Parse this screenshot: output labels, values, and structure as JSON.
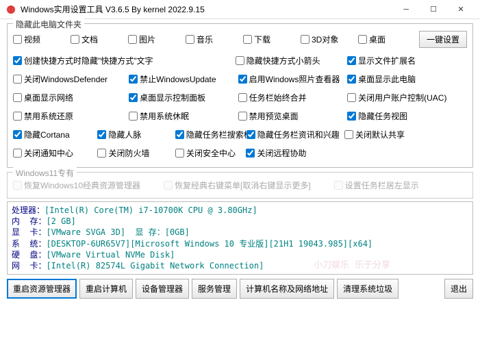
{
  "window": {
    "title": "Windows实用设置工具 V3.6.5 By kernel 2022.9.15"
  },
  "hideFolder": {
    "title": "隐藏此电脑文件夹",
    "items": [
      {
        "label": "视频",
        "checked": false
      },
      {
        "label": "文档",
        "checked": false
      },
      {
        "label": "图片",
        "checked": false
      },
      {
        "label": "音乐",
        "checked": false
      },
      {
        "label": "下载",
        "checked": false
      },
      {
        "label": "3D对象",
        "checked": false
      },
      {
        "label": "桌面",
        "checked": false
      }
    ],
    "batchBtn": "一键设置"
  },
  "opts": [
    {
      "label": "创建快捷方式时隐藏\"快捷方式\"文字",
      "checked": true,
      "span": 2
    },
    {
      "label": "隐藏快捷方式小箭头",
      "checked": false
    },
    {
      "label": "",
      "checked": false,
      "empty": true
    },
    {
      "label": "显示文件扩展名",
      "checked": true
    },
    {
      "label": "关闭WindowsDefender",
      "checked": false
    },
    {
      "label": "禁止WindowsUpdate",
      "checked": true
    },
    {
      "label": "启用Windows照片查看器",
      "checked": true
    },
    {
      "label": "桌面显示此电脑",
      "checked": true
    },
    {
      "label": "桌面显示网络",
      "checked": false
    },
    {
      "label": "桌面显示控制面板",
      "checked": true
    },
    {
      "label": "任务栏始终合并",
      "checked": false
    },
    {
      "label": "关闭用户账户控制(UAC)",
      "checked": false
    },
    {
      "label": "禁用系统还原",
      "checked": false
    },
    {
      "label": "禁用系统休眠",
      "checked": false
    },
    {
      "label": "禁用预览桌面",
      "checked": false
    },
    {
      "label": "隐藏任务视图",
      "checked": true
    },
    {
      "label": "隐藏Cortana",
      "checked": true
    },
    {
      "label": "隐藏人脉",
      "checked": true
    },
    {
      "label": "隐藏任务栏搜索框",
      "checked": true
    },
    {
      "label": "隐藏任务栏资讯和兴趣",
      "checked": true,
      "extra": true
    },
    {
      "label": "关闭默认共享",
      "checked": false
    },
    {
      "label": "关闭通知中心",
      "checked": false
    },
    {
      "label": "关闭防火墙",
      "checked": false
    },
    {
      "label": "关闭安全中心",
      "checked": false
    },
    {
      "label": "关闭远程协助",
      "checked": true,
      "extra": true
    }
  ],
  "win11": {
    "title": "Windows11专有",
    "items": [
      {
        "label": "恢复Windows10经典资源管理器"
      },
      {
        "label": "恢复经典右键菜单[取消右键显示更多]"
      },
      {
        "label": "设置任务栏居左显示"
      }
    ]
  },
  "sysinfo": {
    "cpu": {
      "label": "处理器：",
      "value": "[Intel(R) Core(TM) i7-10700K CPU @ 3.80GHz]"
    },
    "mem": {
      "label": "内  存：",
      "value": "[2 GB]"
    },
    "gpu": {
      "label": "显  卡：",
      "value": "[VMware SVGA 3D]  显 存：[0GB]"
    },
    "sys": {
      "label": "系  统：",
      "value": "[DESKTOP-6UR65V7][Microsoft Windows 10 专业版][21H1 19043.985][x64]"
    },
    "disk": {
      "label": "硬  盘：",
      "value": "[VMware Virtual NVMe Disk]"
    },
    "net": {
      "label": "网  卡：",
      "value": "[Intel(R) 82574L Gigabit Network Connection]"
    }
  },
  "watermark": "小刀娱乐 乐于分享",
  "bottom": {
    "restartExplorer": "重启资源管理器",
    "restartPC": "重启计算机",
    "devmgr": "设备管理器",
    "services": "服务管理",
    "netname": "计算机名称及网络地址",
    "cleanbin": "清理系统垃圾",
    "exit": "退出"
  }
}
